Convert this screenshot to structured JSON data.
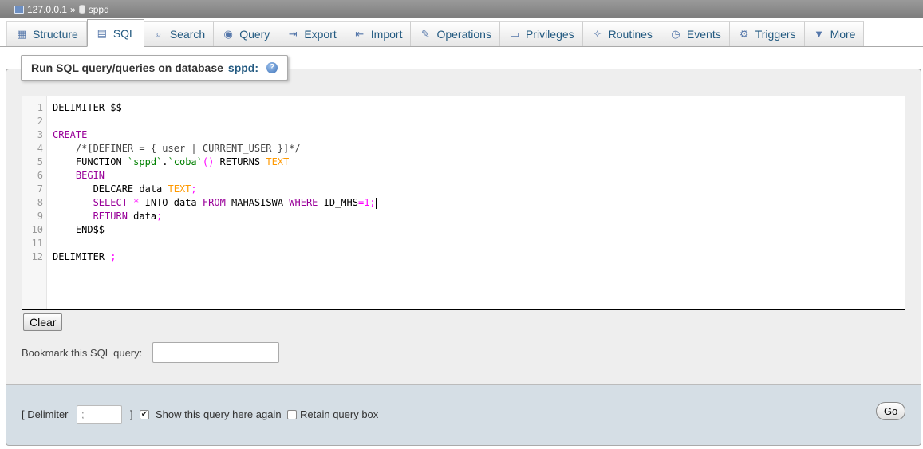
{
  "breadcrumb": {
    "server": "127.0.0.1",
    "separator": "»",
    "database": "sppd"
  },
  "tabs": [
    {
      "label": "Structure",
      "icon": "structure-icon",
      "glyph": "▦"
    },
    {
      "label": "SQL",
      "icon": "sql-icon",
      "glyph": "▤",
      "active": true
    },
    {
      "label": "Search",
      "icon": "search-icon",
      "glyph": "⌕"
    },
    {
      "label": "Query",
      "icon": "query-icon",
      "glyph": "◉"
    },
    {
      "label": "Export",
      "icon": "export-icon",
      "glyph": "⇥"
    },
    {
      "label": "Import",
      "icon": "import-icon",
      "glyph": "⇤"
    },
    {
      "label": "Operations",
      "icon": "wrench-icon",
      "glyph": "✎"
    },
    {
      "label": "Privileges",
      "icon": "privileges-icon",
      "glyph": "▭"
    },
    {
      "label": "Routines",
      "icon": "routines-icon",
      "glyph": "✧"
    },
    {
      "label": "Events",
      "icon": "clock-icon",
      "glyph": "◷"
    },
    {
      "label": "Triggers",
      "icon": "triggers-icon",
      "glyph": "⚙"
    },
    {
      "label": "More",
      "icon": "chevron-down-icon",
      "glyph": "▼"
    }
  ],
  "query_panel": {
    "legend_prefix": "Run SQL query/queries on database",
    "legend_db": "sppd:",
    "help_glyph": "?"
  },
  "editor": {
    "lines": [
      [
        {
          "t": "DELIMITER $$",
          "c": ""
        }
      ],
      [],
      [
        {
          "t": "CREATE",
          "c": "kw"
        }
      ],
      [
        {
          "t": "    /*[DEFINER = { user | CURRENT_USER }]*/",
          "c": "cmt"
        }
      ],
      [
        {
          "t": "    FUNCTION ",
          "c": ""
        },
        {
          "t": "`sppd`",
          "c": "str"
        },
        {
          "t": ".",
          "c": ""
        },
        {
          "t": "`coba`",
          "c": "str"
        },
        {
          "t": "()",
          "c": "op"
        },
        {
          "t": " RETURNS ",
          "c": ""
        },
        {
          "t": "TEXT",
          "c": "typ"
        }
      ],
      [
        {
          "t": "    BEGIN",
          "c": "kw"
        }
      ],
      [
        {
          "t": "       DELCARE data ",
          "c": ""
        },
        {
          "t": "TEXT",
          "c": "typ"
        },
        {
          "t": ";",
          "c": "op"
        }
      ],
      [
        {
          "t": "       ",
          "c": ""
        },
        {
          "t": "SELECT",
          "c": "kw"
        },
        {
          "t": " ",
          "c": ""
        },
        {
          "t": "*",
          "c": "op"
        },
        {
          "t": " INTO data ",
          "c": ""
        },
        {
          "t": "FROM",
          "c": "kw"
        },
        {
          "t": " MAHASISWA ",
          "c": ""
        },
        {
          "t": "WHERE",
          "c": "kw"
        },
        {
          "t": " ID_MHS",
          "c": ""
        },
        {
          "t": "=1;",
          "c": "op"
        },
        {
          "t": "|CURSOR|",
          "c": "cursor"
        }
      ],
      [
        {
          "t": "       ",
          "c": ""
        },
        {
          "t": "RETURN",
          "c": "kw"
        },
        {
          "t": " data",
          "c": ""
        },
        {
          "t": ";",
          "c": "op"
        }
      ],
      [
        {
          "t": "    END$$",
          "c": ""
        }
      ],
      [],
      [
        {
          "t": "DELIMITER ",
          "c": ""
        },
        {
          "t": ";",
          "c": "op"
        }
      ]
    ]
  },
  "buttons": {
    "clear": "Clear",
    "go": "Go"
  },
  "bookmark": {
    "label": "Bookmark this SQL query:",
    "value": ""
  },
  "footer": {
    "delimiter_open": "[ Delimiter",
    "delimiter_value": ";",
    "delimiter_close": "]",
    "show_again_label": "Show this query here again",
    "show_again_checked": true,
    "retain_label": "Retain query box",
    "retain_checked": false
  }
}
